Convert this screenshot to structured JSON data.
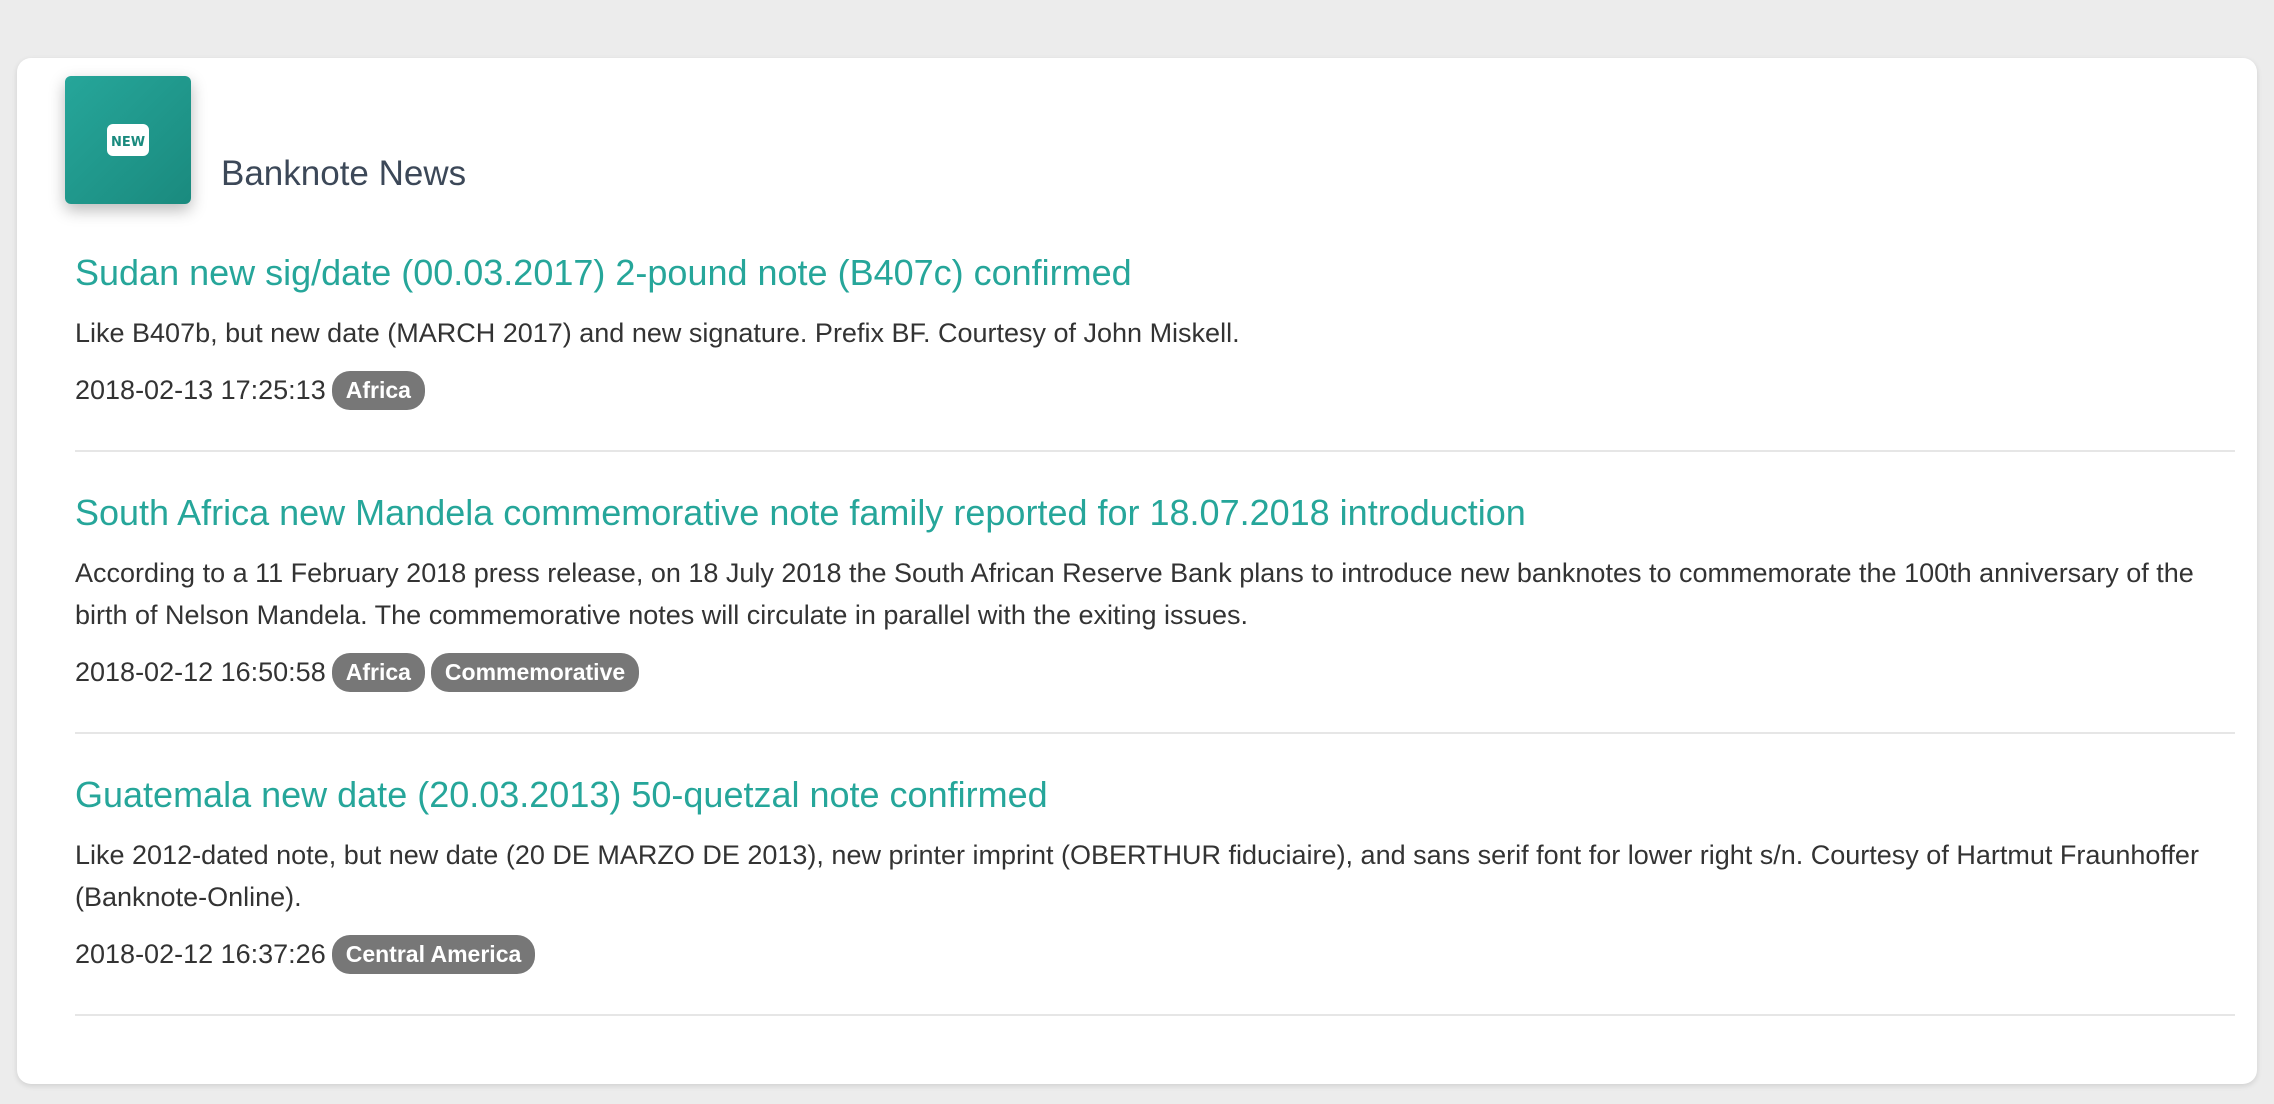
{
  "card": {
    "icon": "new-badge-icon",
    "icon_text": "NEW",
    "title": "Banknote News"
  },
  "accent_color": "#26a69a",
  "badge_color": "#777777",
  "news": [
    {
      "title": "Sudan new sig/date (00.03.2017) 2-pound note (B407c) confirmed",
      "description": "Like B407b, but new date (MARCH 2017) and new signature. Prefix BF. Courtesy of John Miskell.",
      "date": "2018-02-13 17:25:13",
      "tags": [
        "Africa"
      ]
    },
    {
      "title": "South Africa new Mandela commemorative note family reported for 18.07.2018 introduction",
      "description": "According to a 11 February 2018 press release, on 18 July 2018 the South African Reserve Bank plans to introduce new banknotes to commemorate the 100th anniversary of the birth of Nelson Mandela. The commemorative notes will circulate in parallel with the exiting issues.",
      "date": "2018-02-12 16:50:58",
      "tags": [
        "Africa",
        "Commemorative"
      ]
    },
    {
      "title": "Guatemala new date (20.03.2013) 50-quetzal note confirmed",
      "description": "Like 2012-dated note, but new date (20 DE MARZO DE 2013), new printer imprint (OBERTHUR fiduciaire), and sans serif font for lower right s/n. Courtesy of Hartmut Fraunhoffer (Banknote-Online).",
      "date": "2018-02-12 16:37:26",
      "tags": [
        "Central America"
      ]
    }
  ]
}
